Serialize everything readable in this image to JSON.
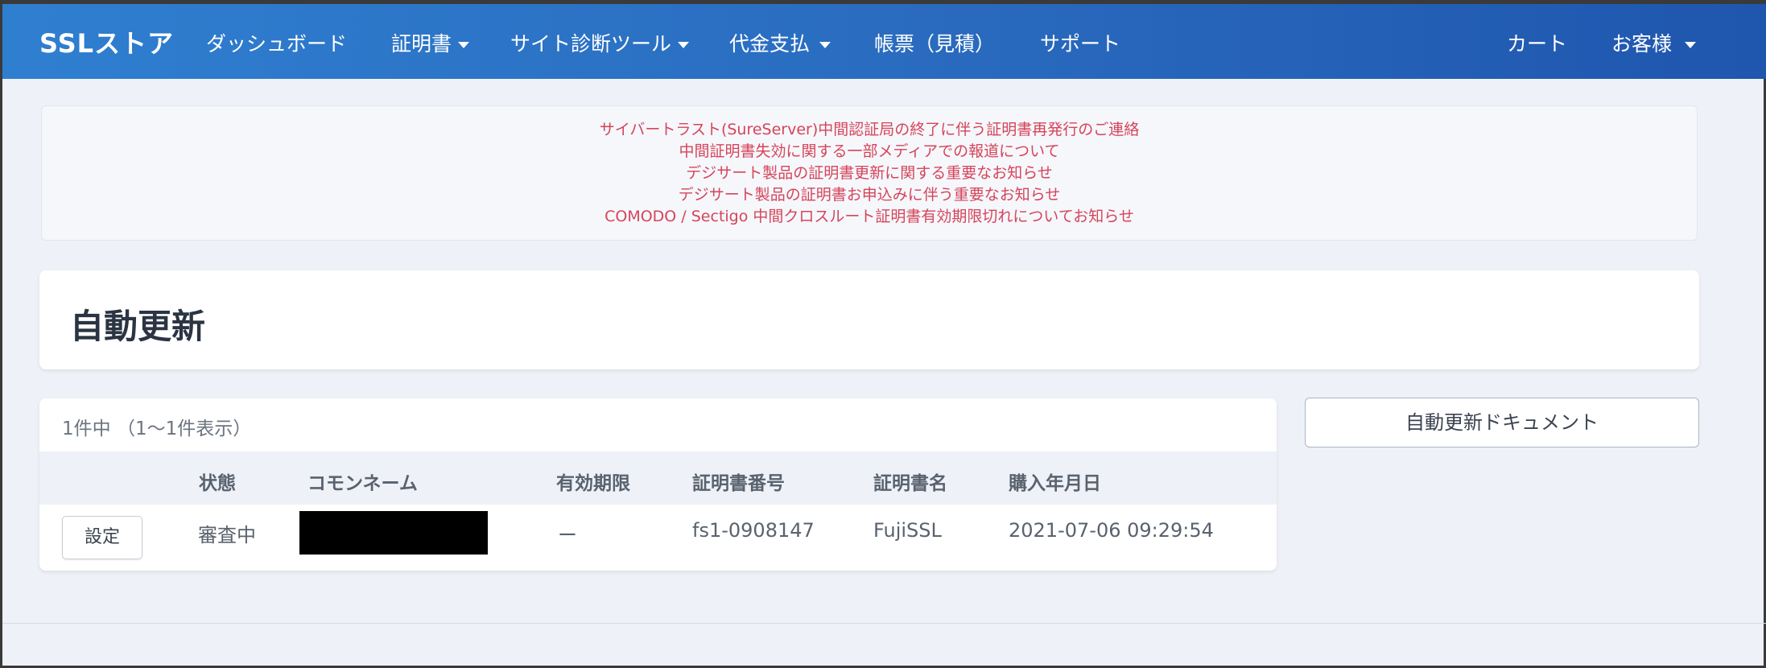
{
  "navbar": {
    "brand": "SSLストア",
    "items": [
      {
        "label": "ダッシュボード"
      },
      {
        "label": "証明書"
      },
      {
        "label": "サイト診断ツール"
      },
      {
        "label": "代金支払"
      },
      {
        "label": "帳票（見積）"
      },
      {
        "label": "サポート"
      }
    ],
    "right": [
      {
        "label": "カート"
      },
      {
        "label": "お客様"
      }
    ]
  },
  "notices": [
    "サイバートラスト(SureServer)中間認証局の終了に伴う証明書再発行のご連絡",
    "中間証明書失効に関する一部メディアでの報道について",
    "デジサート製品の証明書更新に関する重要なお知らせ",
    "デジサート製品の証明書お申込みに伴う重要なお知らせ",
    "COMODO / Sectigo 中間クロスルート証明書有効期限切れについてお知らせ"
  ],
  "page": {
    "title": "自動更新",
    "doc_button": "自動更新ドキュメント"
  },
  "table": {
    "count": "1件中 （1〜1件表示）",
    "headers": {
      "status": "状態",
      "common_name": "コモンネーム",
      "expiry": "有効期限",
      "cert_number": "証明書番号",
      "cert_name": "証明書名",
      "purchase_date": "購入年月日"
    },
    "rows": [
      {
        "action": "設定",
        "status": "審査中",
        "common_name": "",
        "expiry": "ー",
        "cert_number": "fs1-0908147",
        "cert_name": "FujiSSL",
        "purchase_date": "2021-07-06 09:29:54"
      }
    ]
  },
  "colors": {
    "navbar_start": "#2f7fd0",
    "navbar_end": "#1f56ae",
    "notice_text": "#d6445a",
    "background": "#eef1f7"
  }
}
